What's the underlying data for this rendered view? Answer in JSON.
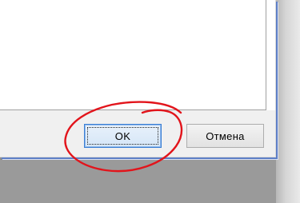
{
  "dialog": {
    "buttons": {
      "ok_label": "OK",
      "cancel_label": "Отмена"
    }
  },
  "annotation": {
    "shape": "hand-drawn ellipse",
    "color": "#e2141b",
    "target": "ok-button"
  },
  "colors": {
    "window_border_accent": "#5e7fc6",
    "default_button_border": "#3b7fd4"
  }
}
